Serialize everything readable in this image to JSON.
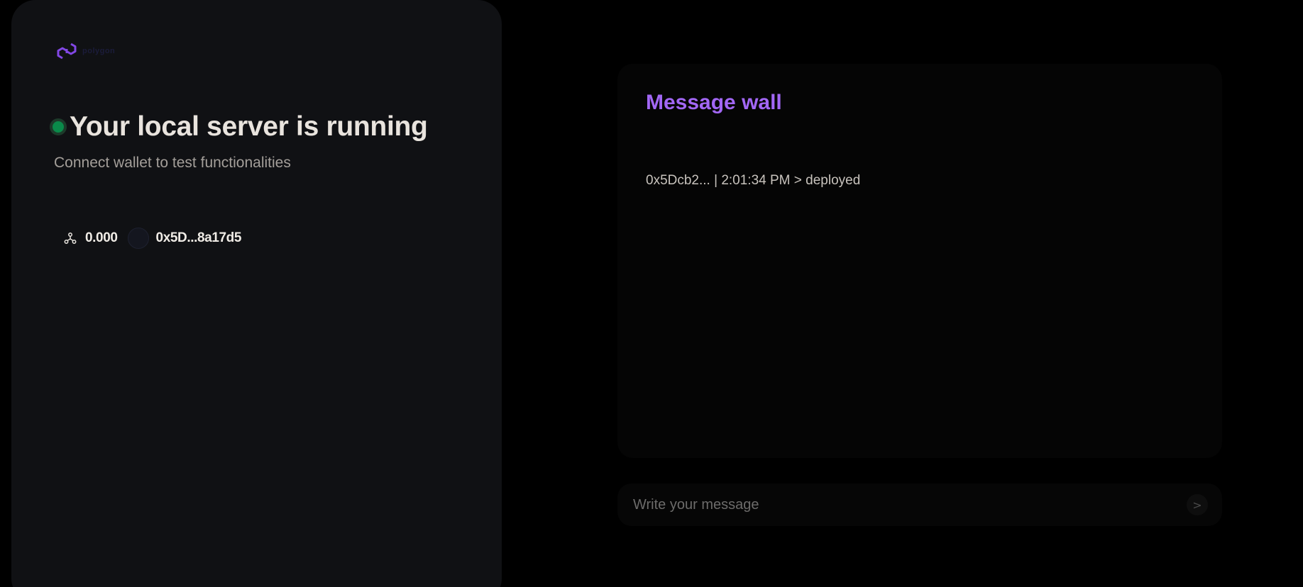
{
  "brand": {
    "logo_icon": "polygon-logo-icon",
    "logo_line1": "polygon",
    "logo_line2": "",
    "accent_color": "#8247e5"
  },
  "status": {
    "indicator_color": "#0a8a4a",
    "title": "Your local server is running",
    "subtitle": "Connect wallet to test functionalities"
  },
  "wallet": {
    "network_icon": "network-icon",
    "balance": "0.000",
    "address": "0x5D...8a17d5"
  },
  "message_wall": {
    "title": "Message wall",
    "title_color": "#a267f5",
    "messages": [
      {
        "text": "0x5Dcb2... | 2:01:34 PM > deployed"
      }
    ]
  },
  "composer": {
    "placeholder": "Write your message",
    "send_label": ">"
  }
}
